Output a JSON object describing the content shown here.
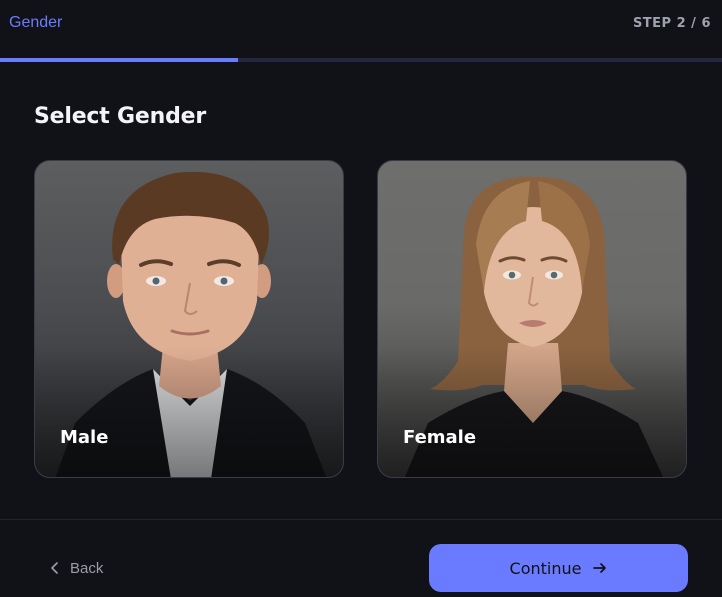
{
  "header": {
    "title": "Gender",
    "step": "STEP 2 / 6"
  },
  "progress": {
    "fraction": 0.33
  },
  "section": {
    "title": "Select Gender"
  },
  "options": [
    {
      "label": "Male",
      "icon": "male-portrait-photo"
    },
    {
      "label": "Female",
      "icon": "female-portrait-photo"
    }
  ],
  "footer": {
    "back_label": "Back",
    "back_icon": "chevron-left-icon",
    "continue_label": "Continue",
    "continue_icon": "arrow-right-icon"
  },
  "colors": {
    "accent": "#6b7bff",
    "background": "#111218",
    "card_border": "#3a3c48"
  }
}
